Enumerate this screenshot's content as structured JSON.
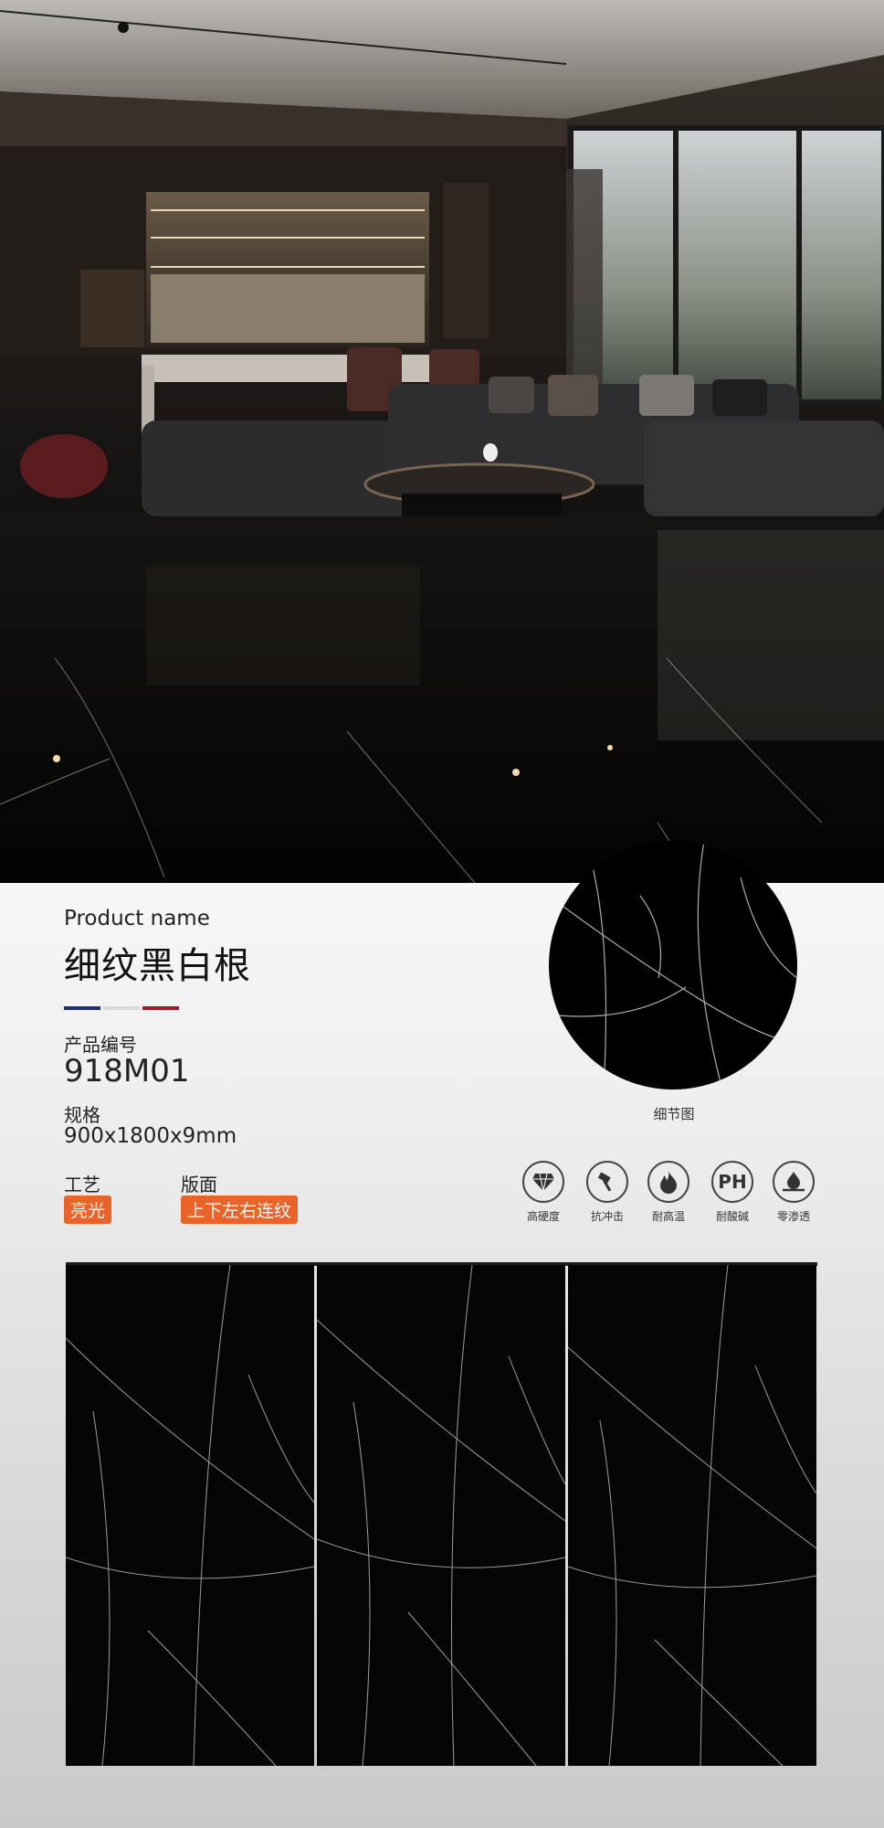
{
  "product": {
    "label_en": "Product name",
    "name": "细纹黑白根",
    "code_label": "产品编号",
    "code": "918M01",
    "spec_label": "规格",
    "spec": "900x1800x9mm",
    "craft_label": "工艺",
    "craft": "亮光",
    "layout_label": "版面",
    "layout": "上下左右连纹"
  },
  "detail": {
    "caption": "细节图"
  },
  "features": [
    {
      "icon": "diamond-icon",
      "label": "高硬度"
    },
    {
      "icon": "hammer-icon",
      "label": "抗冲击"
    },
    {
      "icon": "flame-icon",
      "label": "耐高温"
    },
    {
      "icon": "ph-icon",
      "glyph": "PH",
      "label": "耐酸碱"
    },
    {
      "icon": "water-drop-icon",
      "label": "零渗透"
    }
  ],
  "colors": {
    "accent": "#e8642a",
    "bar_blue": "#1f2f6b",
    "bar_red": "#a3192a",
    "slab": "#050505"
  }
}
